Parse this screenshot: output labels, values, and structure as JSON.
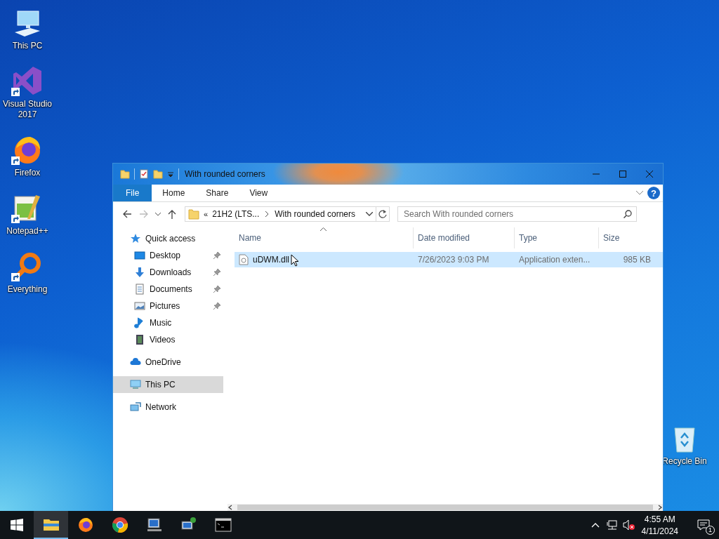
{
  "desktop": {
    "left_column": [
      {
        "label": "This PC",
        "kind": "pc",
        "shortcut": false
      },
      {
        "label": "Visual Studio 2017",
        "kind": "vs",
        "shortcut": true
      },
      {
        "label": "Firefox",
        "kind": "firefox",
        "shortcut": true
      },
      {
        "label": "Notepad++",
        "kind": "notepad",
        "shortcut": true
      },
      {
        "label": "Everything",
        "kind": "everything",
        "shortcut": true
      }
    ],
    "right_column": [
      {
        "label": "Recycle Bin",
        "kind": "bin",
        "shortcut": false
      }
    ]
  },
  "explorer": {
    "title": "With rounded corners",
    "ribbon_tabs": [
      {
        "label": "File",
        "kind": "file",
        "selected": false
      },
      {
        "label": "Home",
        "kind": "tab",
        "selected": false
      },
      {
        "label": "Share",
        "kind": "tab",
        "selected": false
      },
      {
        "label": "View",
        "kind": "tab",
        "selected": false
      }
    ],
    "help": "?",
    "nav_buttons": {
      "back_enabled": true,
      "forward_enabled": false
    },
    "address": {
      "overflow": "«",
      "path": [
        "21H2 (LTS...",
        "With rounded corners"
      ]
    },
    "search": {
      "placeholder": "Search With rounded corners"
    },
    "nav": [
      {
        "label": "Quick access",
        "kind": "star",
        "selected": false,
        "children": [
          {
            "label": "Desktop",
            "kind": "desktop",
            "pinned": true,
            "selected": false
          },
          {
            "label": "Downloads",
            "kind": "downloads",
            "pinned": true,
            "selected": false
          },
          {
            "label": "Documents",
            "kind": "documents",
            "pinned": true,
            "selected": false
          },
          {
            "label": "Pictures",
            "kind": "pictures",
            "pinned": true,
            "selected": false
          },
          {
            "label": "Music",
            "kind": "music",
            "pinned": false,
            "selected": false
          },
          {
            "label": "Videos",
            "kind": "videos",
            "pinned": false,
            "selected": false
          }
        ]
      },
      {
        "label": "OneDrive",
        "kind": "cloud",
        "selected": false
      },
      {
        "label": "This PC",
        "kind": "pc",
        "selected": true
      },
      {
        "label": "Network",
        "kind": "network",
        "selected": false
      }
    ],
    "columns": [
      {
        "label": "Name",
        "sorted": true
      },
      {
        "label": "Date modified",
        "sorted": false
      },
      {
        "label": "Type",
        "sorted": false
      },
      {
        "label": "Size",
        "sorted": false
      }
    ],
    "files": [
      {
        "name": "uDWM.dll",
        "date": "7/26/2023 9:03 PM",
        "type": "Application exten...",
        "size": "985 KB",
        "selected": true
      }
    ]
  },
  "taskbar": {
    "apps": [
      {
        "kind": "explorer",
        "active": true
      },
      {
        "kind": "firefox",
        "active": false
      },
      {
        "kind": "chrome",
        "active": false
      },
      {
        "kind": "remote",
        "active": false
      },
      {
        "kind": "netsetup",
        "active": false
      },
      {
        "kind": "cmd",
        "active": false
      }
    ],
    "volume_muted": true,
    "clock": {
      "time": "4:55 AM",
      "date": "4/11/2024"
    },
    "notifications": {
      "count": "1"
    }
  }
}
